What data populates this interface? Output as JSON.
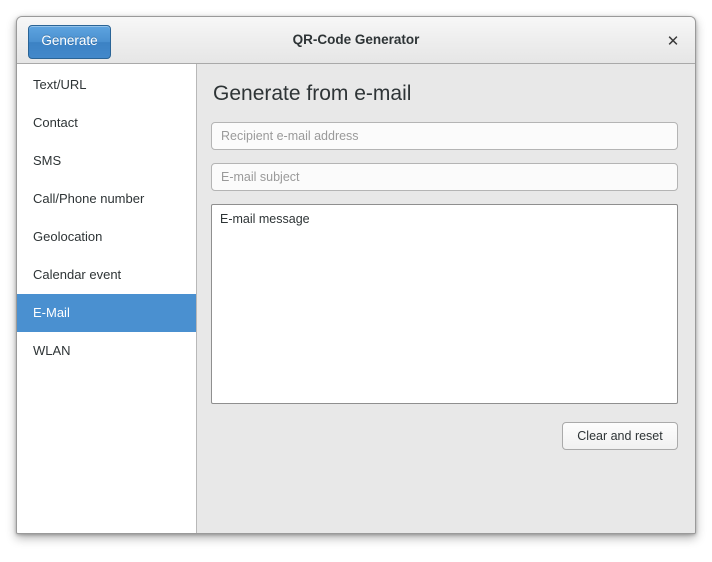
{
  "window": {
    "title": "QR-Code Generator",
    "close_label": "✕"
  },
  "toolbar": {
    "generate_label": "Generate"
  },
  "sidebar": {
    "items": [
      {
        "label": "Text/URL",
        "selected": false
      },
      {
        "label": "Contact",
        "selected": false
      },
      {
        "label": "SMS",
        "selected": false
      },
      {
        "label": "Call/Phone number",
        "selected": false
      },
      {
        "label": "Geolocation",
        "selected": false
      },
      {
        "label": "Calendar event",
        "selected": false
      },
      {
        "label": "E-Mail",
        "selected": true
      },
      {
        "label": "WLAN",
        "selected": false
      }
    ]
  },
  "main": {
    "heading": "Generate from e-mail",
    "recipient": {
      "placeholder": "Recipient e-mail address",
      "value": ""
    },
    "subject": {
      "placeholder": "E-mail subject",
      "value": ""
    },
    "message": {
      "placeholder": "",
      "value": "E-mail message"
    },
    "clear_label": "Clear and reset"
  },
  "colors": {
    "accent": "#4a90d0",
    "panel_bg": "#e8e8e8",
    "sidebar_bg": "#ffffff",
    "text": "#2e3436"
  }
}
